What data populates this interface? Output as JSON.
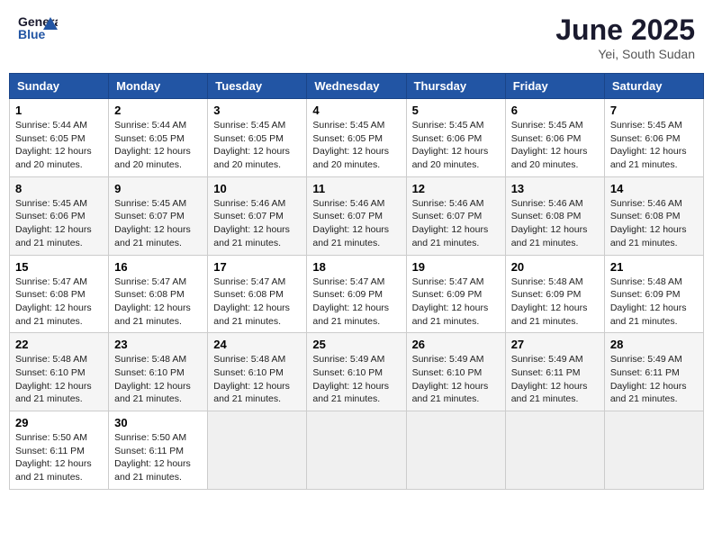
{
  "logo": {
    "general": "General",
    "blue": "Blue"
  },
  "title": "June 2025",
  "location": "Yei, South Sudan",
  "headers": [
    "Sunday",
    "Monday",
    "Tuesday",
    "Wednesday",
    "Thursday",
    "Friday",
    "Saturday"
  ],
  "weeks": [
    [
      {
        "day": "1",
        "info": "Sunrise: 5:44 AM\nSunset: 6:05 PM\nDaylight: 12 hours\nand 20 minutes."
      },
      {
        "day": "2",
        "info": "Sunrise: 5:44 AM\nSunset: 6:05 PM\nDaylight: 12 hours\nand 20 minutes."
      },
      {
        "day": "3",
        "info": "Sunrise: 5:45 AM\nSunset: 6:05 PM\nDaylight: 12 hours\nand 20 minutes."
      },
      {
        "day": "4",
        "info": "Sunrise: 5:45 AM\nSunset: 6:05 PM\nDaylight: 12 hours\nand 20 minutes."
      },
      {
        "day": "5",
        "info": "Sunrise: 5:45 AM\nSunset: 6:06 PM\nDaylight: 12 hours\nand 20 minutes."
      },
      {
        "day": "6",
        "info": "Sunrise: 5:45 AM\nSunset: 6:06 PM\nDaylight: 12 hours\nand 20 minutes."
      },
      {
        "day": "7",
        "info": "Sunrise: 5:45 AM\nSunset: 6:06 PM\nDaylight: 12 hours\nand 21 minutes."
      }
    ],
    [
      {
        "day": "8",
        "info": "Sunrise: 5:45 AM\nSunset: 6:06 PM\nDaylight: 12 hours\nand 21 minutes."
      },
      {
        "day": "9",
        "info": "Sunrise: 5:45 AM\nSunset: 6:07 PM\nDaylight: 12 hours\nand 21 minutes."
      },
      {
        "day": "10",
        "info": "Sunrise: 5:46 AM\nSunset: 6:07 PM\nDaylight: 12 hours\nand 21 minutes."
      },
      {
        "day": "11",
        "info": "Sunrise: 5:46 AM\nSunset: 6:07 PM\nDaylight: 12 hours\nand 21 minutes."
      },
      {
        "day": "12",
        "info": "Sunrise: 5:46 AM\nSunset: 6:07 PM\nDaylight: 12 hours\nand 21 minutes."
      },
      {
        "day": "13",
        "info": "Sunrise: 5:46 AM\nSunset: 6:08 PM\nDaylight: 12 hours\nand 21 minutes."
      },
      {
        "day": "14",
        "info": "Sunrise: 5:46 AM\nSunset: 6:08 PM\nDaylight: 12 hours\nand 21 minutes."
      }
    ],
    [
      {
        "day": "15",
        "info": "Sunrise: 5:47 AM\nSunset: 6:08 PM\nDaylight: 12 hours\nand 21 minutes."
      },
      {
        "day": "16",
        "info": "Sunrise: 5:47 AM\nSunset: 6:08 PM\nDaylight: 12 hours\nand 21 minutes."
      },
      {
        "day": "17",
        "info": "Sunrise: 5:47 AM\nSunset: 6:08 PM\nDaylight: 12 hours\nand 21 minutes."
      },
      {
        "day": "18",
        "info": "Sunrise: 5:47 AM\nSunset: 6:09 PM\nDaylight: 12 hours\nand 21 minutes."
      },
      {
        "day": "19",
        "info": "Sunrise: 5:47 AM\nSunset: 6:09 PM\nDaylight: 12 hours\nand 21 minutes."
      },
      {
        "day": "20",
        "info": "Sunrise: 5:48 AM\nSunset: 6:09 PM\nDaylight: 12 hours\nand 21 minutes."
      },
      {
        "day": "21",
        "info": "Sunrise: 5:48 AM\nSunset: 6:09 PM\nDaylight: 12 hours\nand 21 minutes."
      }
    ],
    [
      {
        "day": "22",
        "info": "Sunrise: 5:48 AM\nSunset: 6:10 PM\nDaylight: 12 hours\nand 21 minutes."
      },
      {
        "day": "23",
        "info": "Sunrise: 5:48 AM\nSunset: 6:10 PM\nDaylight: 12 hours\nand 21 minutes."
      },
      {
        "day": "24",
        "info": "Sunrise: 5:48 AM\nSunset: 6:10 PM\nDaylight: 12 hours\nand 21 minutes."
      },
      {
        "day": "25",
        "info": "Sunrise: 5:49 AM\nSunset: 6:10 PM\nDaylight: 12 hours\nand 21 minutes."
      },
      {
        "day": "26",
        "info": "Sunrise: 5:49 AM\nSunset: 6:10 PM\nDaylight: 12 hours\nand 21 minutes."
      },
      {
        "day": "27",
        "info": "Sunrise: 5:49 AM\nSunset: 6:11 PM\nDaylight: 12 hours\nand 21 minutes."
      },
      {
        "day": "28",
        "info": "Sunrise: 5:49 AM\nSunset: 6:11 PM\nDaylight: 12 hours\nand 21 minutes."
      }
    ],
    [
      {
        "day": "29",
        "info": "Sunrise: 5:50 AM\nSunset: 6:11 PM\nDaylight: 12 hours\nand 21 minutes."
      },
      {
        "day": "30",
        "info": "Sunrise: 5:50 AM\nSunset: 6:11 PM\nDaylight: 12 hours\nand 21 minutes."
      },
      {
        "day": "",
        "info": ""
      },
      {
        "day": "",
        "info": ""
      },
      {
        "day": "",
        "info": ""
      },
      {
        "day": "",
        "info": ""
      },
      {
        "day": "",
        "info": ""
      }
    ]
  ]
}
